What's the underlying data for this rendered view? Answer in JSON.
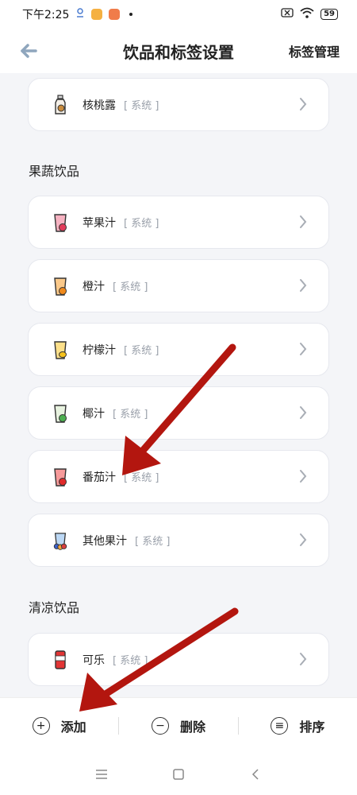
{
  "status_bar": {
    "time": "下午2:25",
    "battery": "59"
  },
  "header": {
    "title": "饮品和标签设置",
    "action_label": "标签管理"
  },
  "sections": [
    {
      "title": "",
      "items": [
        {
          "name": "核桃露",
          "tag": "[ 系统 ]",
          "icon": "walnut-milk-bottle-icon"
        }
      ]
    },
    {
      "title": "果蔬饮品",
      "items": [
        {
          "name": "苹果汁",
          "tag": "[ 系统 ]",
          "icon": "apple-juice-icon"
        },
        {
          "name": "橙汁",
          "tag": "[ 系统 ]",
          "icon": "orange-juice-icon"
        },
        {
          "name": "柠檬汁",
          "tag": "[ 系统 ]",
          "icon": "lemon-juice-icon"
        },
        {
          "name": "椰汁",
          "tag": "[ 系统 ]",
          "icon": "coconut-juice-icon"
        },
        {
          "name": "番茄汁",
          "tag": "[ 系统 ]",
          "icon": "tomato-juice-icon"
        },
        {
          "name": "其他果汁",
          "tag": "[ 系统 ]",
          "icon": "other-juice-icon"
        }
      ]
    },
    {
      "title": "清凉饮品",
      "items": [
        {
          "name": "可乐",
          "tag": "[ 系统 ]",
          "icon": "cola-can-icon"
        }
      ]
    }
  ],
  "bottom_actions": {
    "add_label": "添加",
    "delete_label": "删除",
    "sort_label": "排序"
  },
  "colors": {
    "page_background": "#f4f5f8",
    "card_background": "#ffffff",
    "tag_text": "#9aa0aa",
    "back_arrow": "#8fa6bd",
    "annotation_arrow": "#b3160f"
  }
}
